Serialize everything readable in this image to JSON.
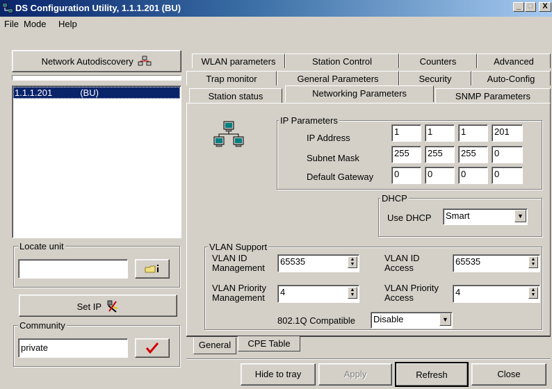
{
  "window": {
    "title": "DS Configuration Utility, 1.1.1.201  (BU)",
    "minimize": "_",
    "maximize": "□",
    "close": "X"
  },
  "menu": [
    "File",
    "Mode",
    "Help"
  ],
  "left": {
    "autodiscovery_button": "Network Autodiscovery",
    "units": [
      {
        "ip": "1.1.1.201",
        "role": "(BU)"
      }
    ],
    "locate_unit": {
      "legend": "Locate unit",
      "value": ""
    },
    "set_ip_button": "Set IP",
    "community": {
      "legend": "Community",
      "value": "private"
    }
  },
  "tabs": {
    "row1": [
      "WLAN parameters",
      "Station Control",
      "Counters",
      "Advanced"
    ],
    "row2": [
      "Trap monitor",
      "General Parameters",
      "Security",
      "Auto-Config"
    ],
    "row3": [
      "Station status",
      "Networking Parameters",
      "SNMP Parameters"
    ],
    "active": "Networking Parameters"
  },
  "ip_params": {
    "legend": "IP Parameters",
    "ip_label": "IP Address",
    "ip": [
      "1",
      "1",
      "1",
      "201"
    ],
    "mask_label": "Subnet Mask",
    "mask": [
      "255",
      "255",
      "255",
      "0"
    ],
    "gw_label": "Default Gateway",
    "gw": [
      "0",
      "0",
      "0",
      "0"
    ]
  },
  "dhcp": {
    "legend": "DHCP",
    "label": "Use DHCP",
    "value": "Smart"
  },
  "vlan": {
    "legend": "VLAN Support",
    "id_mgmt_label_1": "VLAN ID",
    "id_mgmt_label_2": "Management",
    "id_mgmt_value": "65535",
    "id_access_label_1": "VLAN ID",
    "id_access_label_2": "Access",
    "id_access_value": "65535",
    "prio_mgmt_label_1": "VLAN Priority",
    "prio_mgmt_label_2": "Management",
    "prio_mgmt_value": "4",
    "prio_access_label_1": "VLAN Priority",
    "prio_access_label_2": "Access",
    "prio_access_value": "4",
    "compat_label": "802.1Q Compatible",
    "compat_value": "Disable"
  },
  "bottom_tabs": [
    "General",
    "CPE Table"
  ],
  "buttons": {
    "hide": "Hide to tray",
    "apply": "Apply",
    "refresh": "Refresh",
    "close": "Close"
  },
  "colors": {
    "window_bg": "#d4d0c8",
    "titlebar": "#0a246a",
    "selection": "#0a246a",
    "checkmark": "#d40000",
    "disabled_text": "#808080"
  }
}
